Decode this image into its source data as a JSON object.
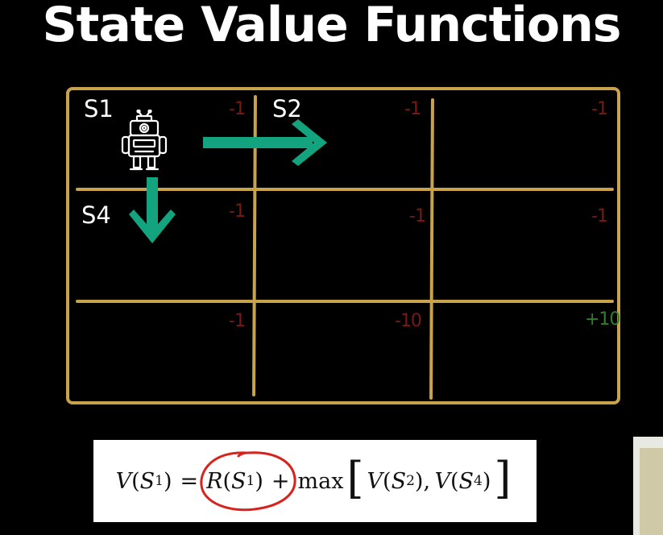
{
  "title": "State Value Functions",
  "grid": {
    "rows": [
      [
        "-1",
        "-1",
        "-1"
      ],
      [
        "-1",
        "-1",
        "-1"
      ],
      [
        "-1",
        "-10",
        "+10"
      ]
    ],
    "states": {
      "s1": "S1",
      "s2": "S2",
      "s4": "S4"
    },
    "colors": {
      "grid": "#c9a24c",
      "negative": "#7a1a16",
      "positive": "#2f7f2a",
      "arrow": "#14a37f"
    },
    "robot_icon": "robot-icon",
    "arrows": [
      "arrow-right-icon",
      "arrow-down-icon"
    ]
  },
  "equation": {
    "lhs_v": "V",
    "lhs_s": "S",
    "lhs_sub": "1",
    "eq": "=",
    "r": "R",
    "r_s": "S",
    "r_sub": "1",
    "plus": "+",
    "max": "max",
    "v2": "V",
    "s2": "S",
    "sub2": "2",
    "comma": ",",
    "v4": "V",
    "s4": "S",
    "sub4": "4",
    "highlight_color": "#d8231c"
  }
}
